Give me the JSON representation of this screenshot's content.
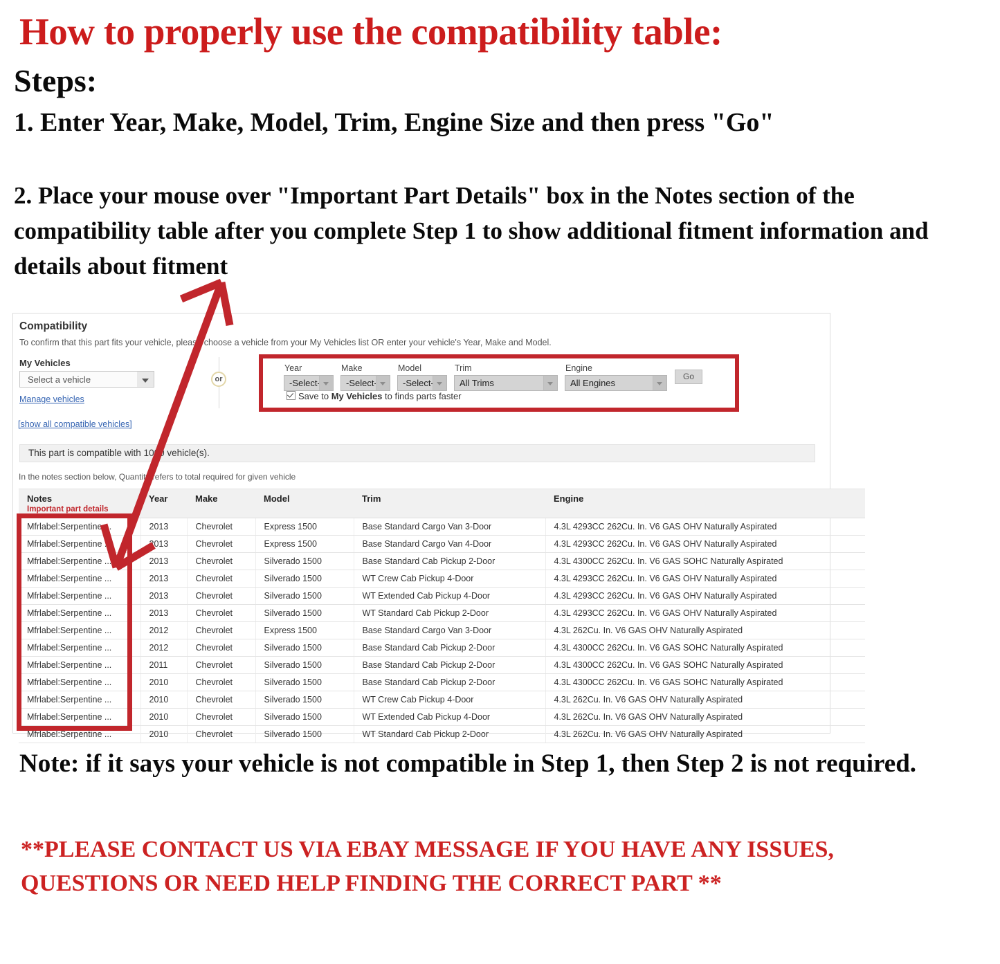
{
  "instructions": {
    "headline": "How to properly use the compatibility table:",
    "steps_label": "Steps:",
    "step1": "1. Enter Year, Make, Model, Trim, Engine Size and then press \"Go\"",
    "step2": "2. Place your mouse over \"Important Part Details\" box in the Notes section of the compatibility table after you complete Step 1 to show additional fitment information and details about fitment",
    "note": "Note: if it says your vehicle is not compatible in Step 1, then Step 2 is not required.",
    "contact": "**PLEASE CONTACT US VIA EBAY MESSAGE IF YOU HAVE ANY ISSUES, QUESTIONS OR NEED HELP FINDING THE CORRECT PART **"
  },
  "compatibility": {
    "title": "Compatibility",
    "subtitle": "To confirm that this part fits your vehicle, please choose a vehicle from your My Vehicles list OR enter your vehicle's Year, Make and Model.",
    "my_vehicles_label": "My Vehicles",
    "vehicle_select_value": "Select a vehicle",
    "manage_vehicles_link": "Manage vehicles",
    "show_all_link": "[show all compatible vehicles]",
    "or_label": "or",
    "fields": [
      {
        "label": "Year",
        "value": "-Select-"
      },
      {
        "label": "Make",
        "value": "-Select-"
      },
      {
        "label": "Model",
        "value": "-Select-"
      },
      {
        "label": "Trim",
        "value": "All Trims"
      },
      {
        "label": "Engine",
        "value": "All Engines"
      }
    ],
    "go_button": "Go",
    "save_prefix": "Save to ",
    "save_bold": "My Vehicles",
    "save_suffix": " to finds parts faster",
    "banner": "This part is compatible with 1000 vehicle(s).",
    "notes_hint": "In the notes section below, Quantity refers to total required for given vehicle"
  },
  "fitment_table": {
    "headers": {
      "notes": "Notes",
      "notes_sub": "Important part details",
      "year": "Year",
      "make": "Make",
      "model": "Model",
      "trim": "Trim",
      "engine": "Engine"
    },
    "rows": [
      {
        "notes": "Mfrlabel:Serpentine ...",
        "year": "2013",
        "make": "Chevrolet",
        "model": "Express 1500",
        "trim": "Base Standard Cargo Van 3-Door",
        "engine": "4.3L 4293CC 262Cu. In. V6 GAS OHV Naturally Aspirated"
      },
      {
        "notes": "Mfrlabel:Serpentine ...",
        "year": "2013",
        "make": "Chevrolet",
        "model": "Express 1500",
        "trim": "Base Standard Cargo Van 4-Door",
        "engine": "4.3L 4293CC 262Cu. In. V6 GAS OHV Naturally Aspirated"
      },
      {
        "notes": "Mfrlabel:Serpentine ...",
        "year": "2013",
        "make": "Chevrolet",
        "model": "Silverado 1500",
        "trim": "Base Standard Cab Pickup 2-Door",
        "engine": "4.3L 4300CC 262Cu. In. V6 GAS SOHC Naturally Aspirated"
      },
      {
        "notes": "Mfrlabel:Serpentine ...",
        "year": "2013",
        "make": "Chevrolet",
        "model": "Silverado 1500",
        "trim": "WT Crew Cab Pickup 4-Door",
        "engine": "4.3L 4293CC 262Cu. In. V6 GAS OHV Naturally Aspirated"
      },
      {
        "notes": "Mfrlabel:Serpentine ...",
        "year": "2013",
        "make": "Chevrolet",
        "model": "Silverado 1500",
        "trim": "WT Extended Cab Pickup 4-Door",
        "engine": "4.3L 4293CC 262Cu. In. V6 GAS OHV Naturally Aspirated"
      },
      {
        "notes": "Mfrlabel:Serpentine ...",
        "year": "2013",
        "make": "Chevrolet",
        "model": "Silverado 1500",
        "trim": "WT Standard Cab Pickup 2-Door",
        "engine": "4.3L 4293CC 262Cu. In. V6 GAS OHV Naturally Aspirated"
      },
      {
        "notes": "Mfrlabel:Serpentine ...",
        "year": "2012",
        "make": "Chevrolet",
        "model": "Express 1500",
        "trim": "Base Standard Cargo Van 3-Door",
        "engine": "4.3L 262Cu. In. V6 GAS OHV Naturally Aspirated"
      },
      {
        "notes": "Mfrlabel:Serpentine ...",
        "year": "2012",
        "make": "Chevrolet",
        "model": "Silverado 1500",
        "trim": "Base Standard Cab Pickup 2-Door",
        "engine": "4.3L 4300CC 262Cu. In. V6 GAS SOHC Naturally Aspirated"
      },
      {
        "notes": "Mfrlabel:Serpentine ...",
        "year": "2011",
        "make": "Chevrolet",
        "model": "Silverado 1500",
        "trim": "Base Standard Cab Pickup 2-Door",
        "engine": "4.3L 4300CC 262Cu. In. V6 GAS SOHC Naturally Aspirated"
      },
      {
        "notes": "Mfrlabel:Serpentine ...",
        "year": "2010",
        "make": "Chevrolet",
        "model": "Silverado 1500",
        "trim": "Base Standard Cab Pickup 2-Door",
        "engine": "4.3L 4300CC 262Cu. In. V6 GAS SOHC Naturally Aspirated"
      },
      {
        "notes": "Mfrlabel:Serpentine ...",
        "year": "2010",
        "make": "Chevrolet",
        "model": "Silverado 1500",
        "trim": "WT Crew Cab Pickup 4-Door",
        "engine": "4.3L 262Cu. In. V6 GAS OHV Naturally Aspirated"
      },
      {
        "notes": "Mfrlabel:Serpentine ...",
        "year": "2010",
        "make": "Chevrolet",
        "model": "Silverado 1500",
        "trim": "WT Extended Cab Pickup 4-Door",
        "engine": "4.3L 262Cu. In. V6 GAS OHV Naturally Aspirated"
      },
      {
        "notes": "Mfrlabel:Serpentine ...",
        "year": "2010",
        "make": "Chevrolet",
        "model": "Silverado 1500",
        "trim": "WT Standard Cab Pickup 2-Door",
        "engine": "4.3L 262Cu. In. V6 GAS OHV Naturally Aspirated"
      }
    ]
  },
  "colors": {
    "headline_red": "#cc1c1c",
    "annotation_red": "#c1262c",
    "link_blue": "#3665b3",
    "header_gray": "#f1f1f1"
  }
}
